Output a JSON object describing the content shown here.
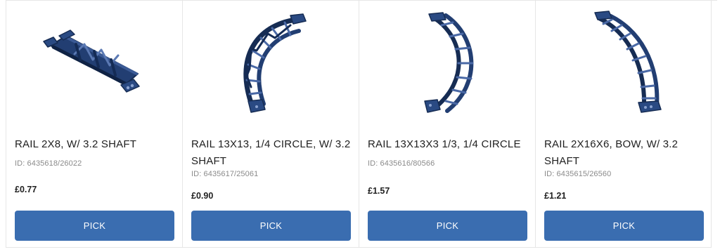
{
  "products": [
    {
      "name": "RAIL 2X8, W/ 3.2 SHAFT",
      "id_label": "ID: 6435618/26022",
      "price": "£0.77",
      "button_label": "PICK",
      "image_icon": "rail-straight-icon"
    },
    {
      "name": "RAIL 13X13, 1/4 CIRCLE, W/ 3.2 SHAFT",
      "id_label": "ID: 6435617/25061",
      "price": "£0.90",
      "button_label": "PICK",
      "image_icon": "rail-quarter-circle-shaft-icon"
    },
    {
      "name": "RAIL 13X13X3 1/3, 1/4 CIRCLE",
      "id_label": "ID: 6435616/80566",
      "price": "£1.57",
      "button_label": "PICK",
      "image_icon": "rail-quarter-circle-icon"
    },
    {
      "name": "RAIL 2X16X6, BOW, W/ 3.2 SHAFT",
      "id_label": "ID: 6435615/26560",
      "price": "£1.21",
      "button_label": "PICK",
      "image_icon": "rail-bow-icon"
    }
  ],
  "colors": {
    "button": "#3a6db0",
    "brick": "#1f3a6b",
    "divider": "#e6e6e6"
  }
}
